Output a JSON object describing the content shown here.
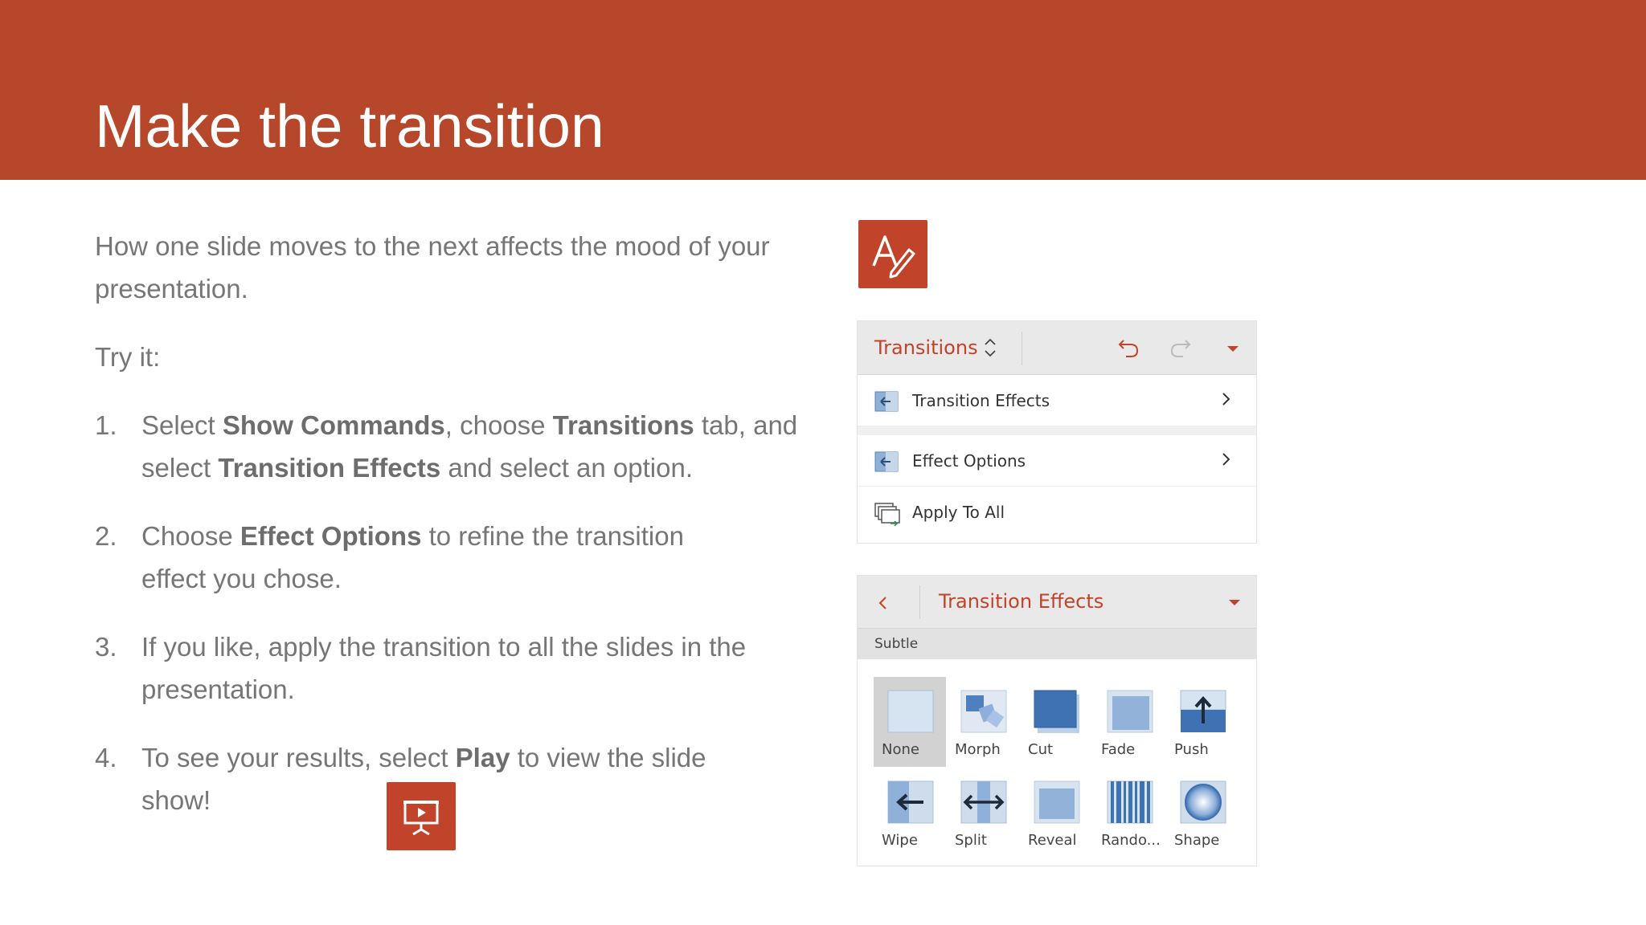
{
  "slide": {
    "title": "Make the transition",
    "intro": "How one slide moves to the next affects the mood of your presentation.",
    "try_it": "Try it:",
    "steps": [
      {
        "num": "1.",
        "parts": [
          "Select ",
          "Show Commands",
          ", choose ",
          "Transitions",
          " tab, and select ",
          "Transition Effects",
          " and select an option."
        ]
      },
      {
        "num": "2.",
        "parts": [
          "Choose ",
          "Effect Options",
          " to refine the transition effect you chose."
        ]
      },
      {
        "num": "3.",
        "text": "If you like, apply the transition to all the slides in the presentation."
      },
      {
        "num": "4.",
        "parts": [
          "To see your results, select ",
          "Play",
          " to view the slide show!"
        ]
      }
    ]
  },
  "icons": {
    "show_commands": "show-commands-icon",
    "play": "play-slideshow-icon"
  },
  "transitions_panel": {
    "tab_label": "Transitions",
    "items": [
      {
        "label": "Transition Effects",
        "icon": "transition-effects-icon"
      },
      {
        "label": "Effect Options",
        "icon": "effect-options-icon"
      },
      {
        "label": "Apply To All",
        "icon": "apply-to-all-icon"
      }
    ]
  },
  "effects_panel": {
    "title": "Transition Effects",
    "section": "Subtle",
    "effects": [
      {
        "label": "None",
        "selected": true
      },
      {
        "label": "Morph"
      },
      {
        "label": "Cut"
      },
      {
        "label": "Fade"
      },
      {
        "label": "Push"
      },
      {
        "label": "Wipe"
      },
      {
        "label": "Split"
      },
      {
        "label": "Reveal"
      },
      {
        "label": "Rando..."
      },
      {
        "label": "Shape"
      }
    ]
  },
  "colors": {
    "accent": "#b7472a",
    "icon_bg": "#c1432a",
    "text": "#767676"
  }
}
